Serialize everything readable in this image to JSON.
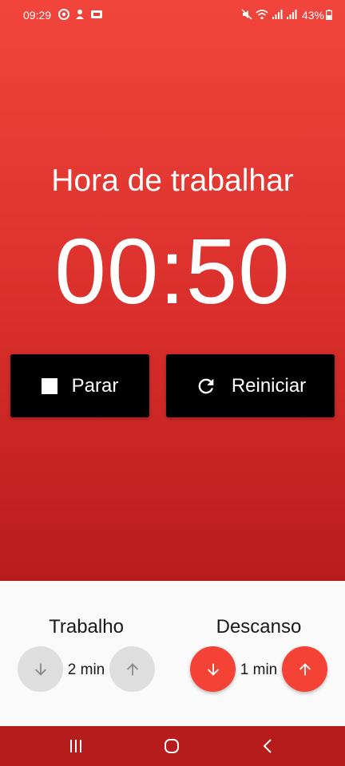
{
  "status_bar": {
    "time": "09:29",
    "battery": "43%",
    "left_icons": [
      "chrome-icon",
      "notification-icon",
      "cast-icon"
    ],
    "right_icons": [
      "mute-icon",
      "wifi-icon",
      "signal-icon",
      "signal-icon",
      "battery-icon"
    ]
  },
  "timer": {
    "mode_title": "Hora de trabalhar",
    "display": "00:50"
  },
  "controls": {
    "stop_label": "Parar",
    "reset_label": "Reiniciar"
  },
  "settings": {
    "work": {
      "label": "Trabalho",
      "value": "2 min"
    },
    "rest": {
      "label": "Descanso",
      "value": "1 min"
    }
  },
  "colors": {
    "primary": "#f44336",
    "primary_dark": "#b71c1c",
    "button_bg": "#000000",
    "disabled": "#dedede"
  }
}
